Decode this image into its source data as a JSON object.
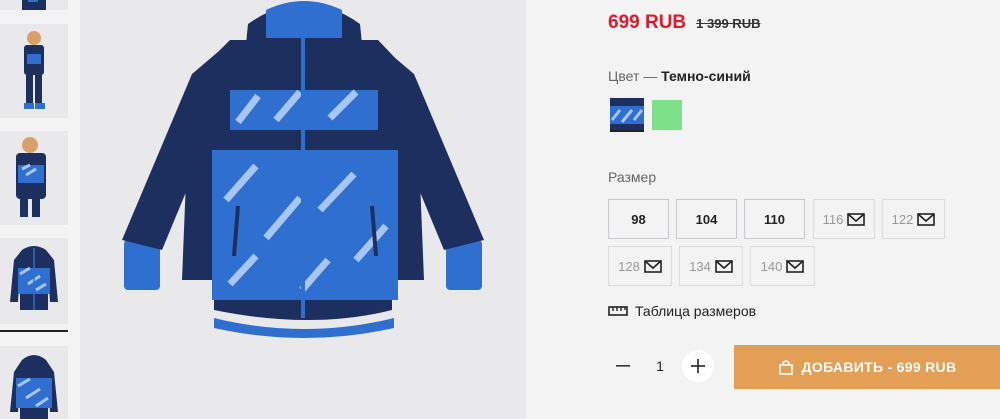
{
  "product": {
    "price": "699 RUB",
    "old_price": "1 399 RUB"
  },
  "color": {
    "label": "Цвет — ",
    "value": "Темно-синий",
    "swatches": [
      {
        "name": "Темно-синий",
        "selected": true,
        "color": "#1c2f5f"
      },
      {
        "name": "green",
        "selected": false,
        "color": "#7fe08a"
      }
    ]
  },
  "size": {
    "label": "Размер",
    "options": [
      {
        "label": "98",
        "available": true
      },
      {
        "label": "104",
        "available": true
      },
      {
        "label": "110",
        "available": true
      },
      {
        "label": "116",
        "available": false
      },
      {
        "label": "122",
        "available": false
      },
      {
        "label": "128",
        "available": false
      },
      {
        "label": "134",
        "available": false
      },
      {
        "label": "140",
        "available": false
      }
    ]
  },
  "size_table_link": "Таблица размеров",
  "quantity": {
    "value": "1",
    "minus_icon": "minus-icon",
    "plus_icon": "plus-icon"
  },
  "add_to_cart": {
    "label": "ДОБАВИТЬ - 699 RUB",
    "icon": "lock-bag-icon",
    "color": "#e39f56"
  },
  "colors": {
    "price_red": "#e0192c",
    "jacket_navy": "#1c2f5f",
    "jacket_blue": "#2f6fd0"
  }
}
